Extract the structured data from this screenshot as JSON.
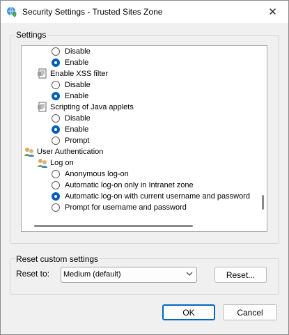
{
  "window": {
    "title": "Security Settings - Trusted Sites Zone",
    "close_glyph": "✕",
    "icon": "globe-shield-icon"
  },
  "settings": {
    "group_label": "Settings",
    "items": [
      {
        "type": "radio",
        "label": "Disable",
        "checked": false
      },
      {
        "type": "radio",
        "label": "Enable",
        "checked": true
      },
      {
        "type": "option",
        "label": "Enable XSS filter",
        "icon": "settings-doc-icon"
      },
      {
        "type": "radio",
        "label": "Disable",
        "checked": false
      },
      {
        "type": "radio",
        "label": "Enable",
        "checked": true
      },
      {
        "type": "option",
        "label": "Scripting of Java applets",
        "icon": "settings-doc-icon"
      },
      {
        "type": "radio",
        "label": "Disable",
        "checked": false
      },
      {
        "type": "radio",
        "label": "Enable",
        "checked": true
      },
      {
        "type": "radio",
        "label": "Prompt",
        "checked": false
      },
      {
        "type": "category",
        "label": "User Authentication",
        "icon": "users-icon"
      },
      {
        "type": "option",
        "label": "Log on",
        "icon": "users-icon"
      },
      {
        "type": "radio",
        "label": "Anonymous log-on",
        "checked": false
      },
      {
        "type": "radio",
        "label": "Automatic log-on only in Intranet zone",
        "checked": false
      },
      {
        "type": "radio",
        "label": "Automatic log-on with current username and password",
        "checked": true
      },
      {
        "type": "radio",
        "label": "Prompt for username and password",
        "checked": false
      }
    ]
  },
  "reset": {
    "group_label": "Reset custom settings",
    "reset_to_label": "Reset to:",
    "selected_value": "Medium (default)",
    "reset_button": "Reset..."
  },
  "footer": {
    "ok_label": "OK",
    "cancel_label": "Cancel"
  }
}
